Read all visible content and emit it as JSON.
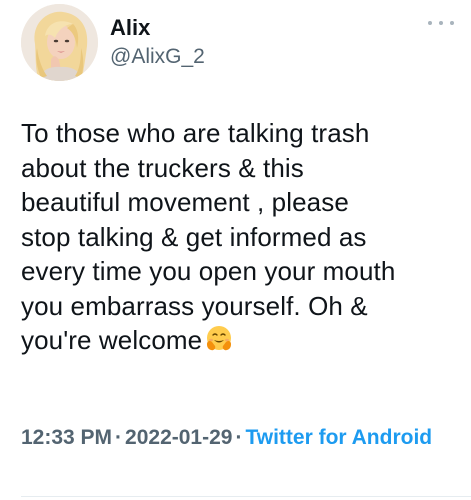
{
  "author": {
    "name": "Alix",
    "handle": "@AlixG_2"
  },
  "more_icon": "more-horizontal-icon",
  "tweet": {
    "lines": [
      "To those who are talking trash",
      "about the truckers & this",
      "beautiful movement , please",
      "stop talking & get informed as",
      "every time you open your mouth",
      "you embarrass yourself. Oh &",
      "you're welcome"
    ],
    "emoji": "hugging-face-emoji"
  },
  "meta": {
    "time": "12:33 PM",
    "separator": "·",
    "date": "2022-01-29",
    "source": "Twitter for Android"
  },
  "colors": {
    "text": "#0f1419",
    "secondary": "#536471",
    "link": "#1d9bf0"
  }
}
